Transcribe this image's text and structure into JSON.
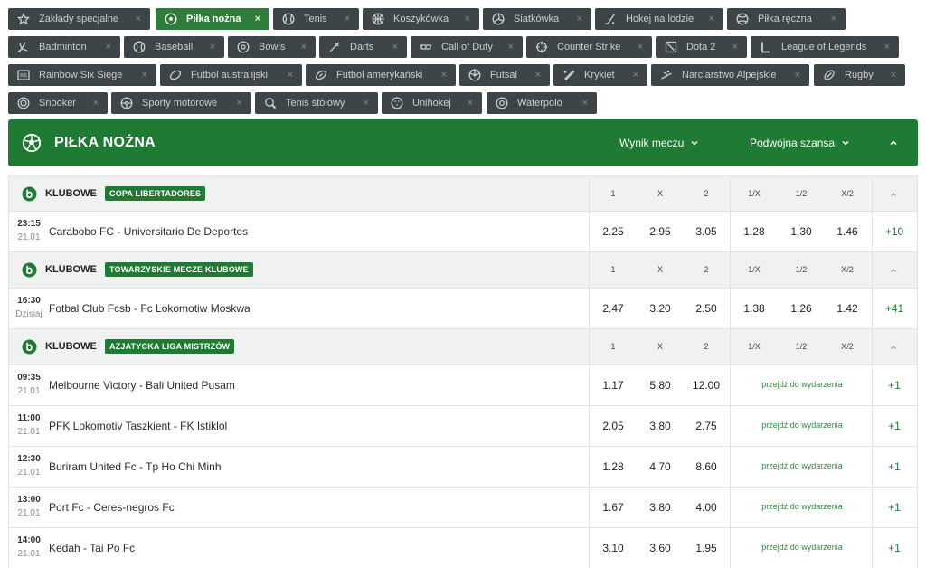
{
  "sport_chips": [
    {
      "label": "Zakłady specjalne",
      "icon": "star-icon",
      "active": false
    },
    {
      "label": "Piłka nożna",
      "icon": "soccer-ball-icon",
      "active": true
    },
    {
      "label": "Tenis",
      "icon": "tennis-ball-icon",
      "active": false
    },
    {
      "label": "Koszykówka",
      "icon": "basketball-icon",
      "active": false
    },
    {
      "label": "Siatkówka",
      "icon": "volleyball-icon",
      "active": false
    },
    {
      "label": "Hokej na lodzie",
      "icon": "hockey-stick-icon",
      "active": false
    },
    {
      "label": "Piłka ręczna",
      "icon": "handball-icon",
      "active": false
    },
    {
      "label": "Badminton",
      "icon": "shuttlecock-icon",
      "active": false
    },
    {
      "label": "Baseball",
      "icon": "baseball-icon",
      "active": false
    },
    {
      "label": "Bowls",
      "icon": "bowls-icon",
      "active": false
    },
    {
      "label": "Darts",
      "icon": "dart-icon",
      "active": false
    },
    {
      "label": "Call of Duty",
      "icon": "call-of-duty-icon",
      "active": false
    },
    {
      "label": "Counter Strike",
      "icon": "crosshair-icon",
      "active": false
    },
    {
      "label": "Dota 2",
      "icon": "dota-icon",
      "active": false
    },
    {
      "label": "League of Legends",
      "icon": "league-of-legends-icon",
      "active": false
    },
    {
      "label": "Rainbow Six Siege",
      "icon": "rainbow-six-icon",
      "active": false
    },
    {
      "label": "Futbol australijski",
      "icon": "australian-football-icon",
      "active": false
    },
    {
      "label": "Futbol amerykański",
      "icon": "american-football-icon",
      "active": false
    },
    {
      "label": "Futsal",
      "icon": "futsal-ball-icon",
      "active": false
    },
    {
      "label": "Krykiet",
      "icon": "cricket-bat-icon",
      "active": false
    },
    {
      "label": "Narciarstwo Alpejskie",
      "icon": "skiing-icon",
      "active": false
    },
    {
      "label": "Rugby",
      "icon": "rugby-ball-icon",
      "active": false
    },
    {
      "label": "Snooker",
      "icon": "snooker-ball-icon",
      "active": false
    },
    {
      "label": "Sporty motorowe",
      "icon": "steering-wheel-icon",
      "active": false
    },
    {
      "label": "Tenis stołowy",
      "icon": "table-tennis-icon",
      "active": false
    },
    {
      "label": "Unihokej",
      "icon": "floorball-icon",
      "active": false
    },
    {
      "label": "Waterpolo",
      "icon": "waterpolo-ball-icon",
      "active": false
    }
  ],
  "chip_close_glyph": "×",
  "section": {
    "title": "PIŁKA NOŻNA",
    "market_1": "Wynik meczu",
    "market_2": "Podwójna szansa"
  },
  "columns": [
    "1",
    "X",
    "2",
    "1/X",
    "1/2",
    "X/2"
  ],
  "leagues": [
    {
      "category": "KLUBOWE",
      "name": "COPA LIBERTADORES",
      "matches": [
        {
          "time": "23:15",
          "date": "21.01",
          "teams": "Carabobo FC - Universitario De Deportes",
          "odds": [
            "2.25",
            "2.95",
            "3.05",
            "1.28",
            "1.30",
            "1.46"
          ],
          "more": "+10",
          "goto": ""
        }
      ]
    },
    {
      "category": "KLUBOWE",
      "name": "TOWARZYSKIE MECZE KLUBOWE",
      "matches": [
        {
          "time": "16:30",
          "date": "Dzisiaj",
          "teams": "Fotbal Club Fcsb - Fc Lokomotiw Moskwa",
          "odds": [
            "2.47",
            "3.20",
            "2.50",
            "1.38",
            "1.26",
            "1.42"
          ],
          "more": "+41",
          "goto": ""
        }
      ]
    },
    {
      "category": "KLUBOWE",
      "name": "AZJATYCKA LIGA MISTRZÓW",
      "matches": [
        {
          "time": "09:35",
          "date": "21.01",
          "teams": "Melbourne Victory - Bali United Pusam",
          "odds": [
            "1.17",
            "5.80",
            "12.00"
          ],
          "more": "+1",
          "goto": "przejdź do wydarzenia"
        },
        {
          "time": "11:00",
          "date": "21.01",
          "teams": "PFK Lokomotiv Taszkient - FK Istiklol",
          "odds": [
            "2.05",
            "3.80",
            "2.75"
          ],
          "more": "+1",
          "goto": "przejdź do wydarzenia"
        },
        {
          "time": "12:30",
          "date": "21.01",
          "teams": "Buriram United Fc - Tp Ho Chi Minh",
          "odds": [
            "1.28",
            "4.70",
            "8.60"
          ],
          "more": "+1",
          "goto": "przejdź do wydarzenia"
        },
        {
          "time": "13:00",
          "date": "21.01",
          "teams": "Port Fc - Ceres-negros Fc",
          "odds": [
            "1.67",
            "3.80",
            "4.00"
          ],
          "more": "+1",
          "goto": "przejdź do wydarzenia"
        },
        {
          "time": "14:00",
          "date": "21.01",
          "teams": "Kedah - Tai Po Fc",
          "odds": [
            "3.10",
            "3.60",
            "1.95"
          ],
          "more": "+1",
          "goto": "przejdź do wydarzenia"
        }
      ]
    }
  ],
  "colors": {
    "brand_green": "#1f7a34",
    "chip_bg": "#3e4548",
    "chip_active_bg": "#2e7d3a",
    "row_header_bg": "#f0f1f1"
  }
}
